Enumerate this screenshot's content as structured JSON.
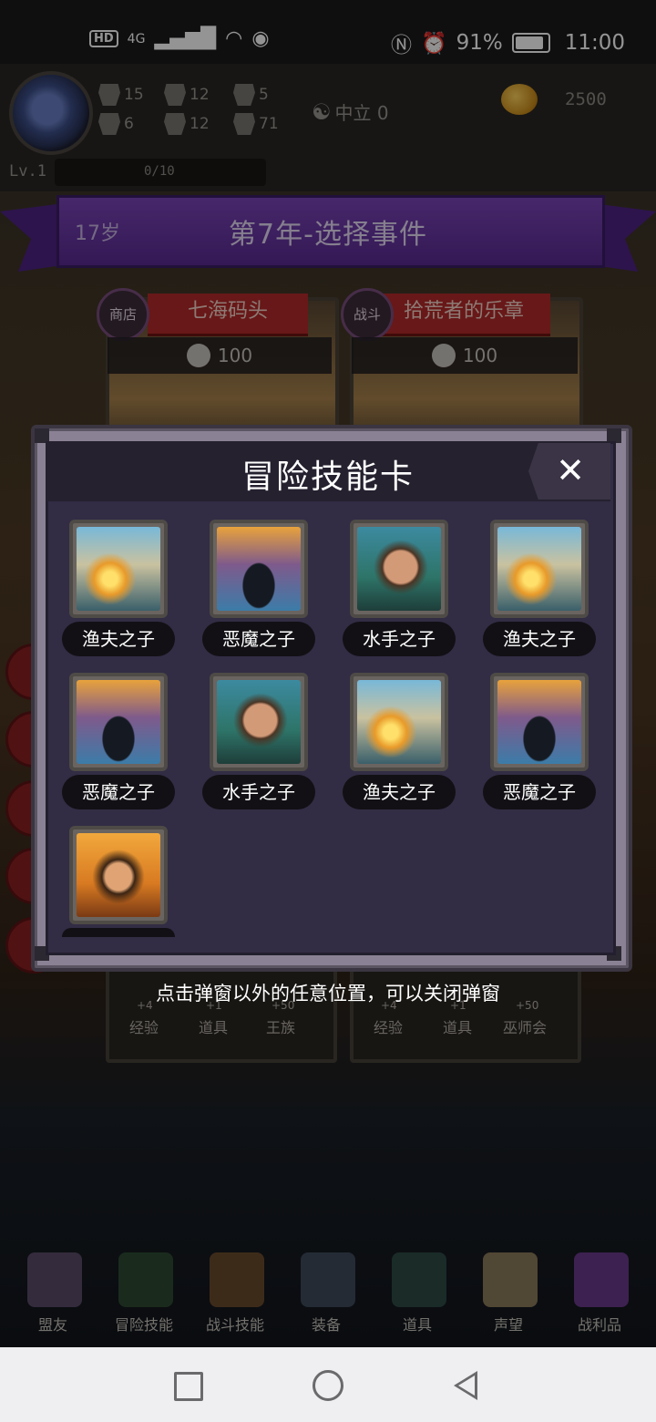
{
  "status_bar": {
    "left": {
      "hd": "HD",
      "network": "4G"
    },
    "battery_percent": "91%",
    "time": "11:00"
  },
  "player": {
    "stats": [
      {
        "icon": "fist-icon",
        "value": "15"
      },
      {
        "icon": "clover-icon",
        "value": "6"
      },
      {
        "icon": "boot-icon",
        "value": "12"
      },
      {
        "icon": "armor-icon",
        "value": "12"
      },
      {
        "icon": "wizard-hat-icon",
        "value": "5"
      },
      {
        "icon": "leaf-icon",
        "value": "71"
      }
    ],
    "alignment": "中立 0",
    "gold": "2500",
    "level": "Lv.1",
    "exp": "0/10"
  },
  "banner": {
    "age": "17岁",
    "title": "第7年-选择事件"
  },
  "events": [
    {
      "tag": "商店",
      "name": "七海码头",
      "cost": "100"
    },
    {
      "tag": "战斗",
      "name": "拾荒者的乐章",
      "cost": "100"
    }
  ],
  "reward_rows": [
    {
      "items": [
        {
          "value": "+4",
          "label": "经验"
        },
        {
          "value": "+1",
          "label": "道具"
        },
        {
          "value": "+50",
          "label": "王族"
        }
      ]
    },
    {
      "items": [
        {
          "value": "+4",
          "label": "经验"
        },
        {
          "value": "+1",
          "label": "道具"
        },
        {
          "value": "+50",
          "label": "巫师会"
        }
      ]
    }
  ],
  "modal": {
    "title": "冒险技能卡",
    "close_symbol": "✕",
    "cards": [
      {
        "portrait": "fisher",
        "label": "渔夫之子"
      },
      {
        "portrait": "demon",
        "label": "恶魔之子"
      },
      {
        "portrait": "sailor",
        "label": "水手之子"
      },
      {
        "portrait": "fisher",
        "label": "渔夫之子"
      },
      {
        "portrait": "demon",
        "label": "恶魔之子"
      },
      {
        "portrait": "sailor",
        "label": "水手之子"
      },
      {
        "portrait": "fisher",
        "label": "渔夫之子"
      },
      {
        "portrait": "demon",
        "label": "恶魔之子"
      },
      {
        "portrait": "hero",
        "label": ""
      }
    ]
  },
  "hint": "点击弹窗以外的任意位置，可以关闭弹窗",
  "bottom_nav": [
    {
      "icon": "allies-icon",
      "label": "盟友"
    },
    {
      "icon": "spellbook-icon",
      "label": "冒险技能"
    },
    {
      "icon": "backpack-icon",
      "label": "战斗技能"
    },
    {
      "icon": "swords-icon",
      "label": "装备"
    },
    {
      "icon": "pouch-icon",
      "label": "道具"
    },
    {
      "icon": "scroll-icon",
      "label": "声望"
    },
    {
      "icon": "chest-icon",
      "label": "战利品"
    }
  ],
  "colors": {
    "banner_purple": "#6a36a6",
    "event_ribbon_red": "#b32a2a",
    "modal_bg": "#322c44",
    "label_pill": "#121014"
  }
}
